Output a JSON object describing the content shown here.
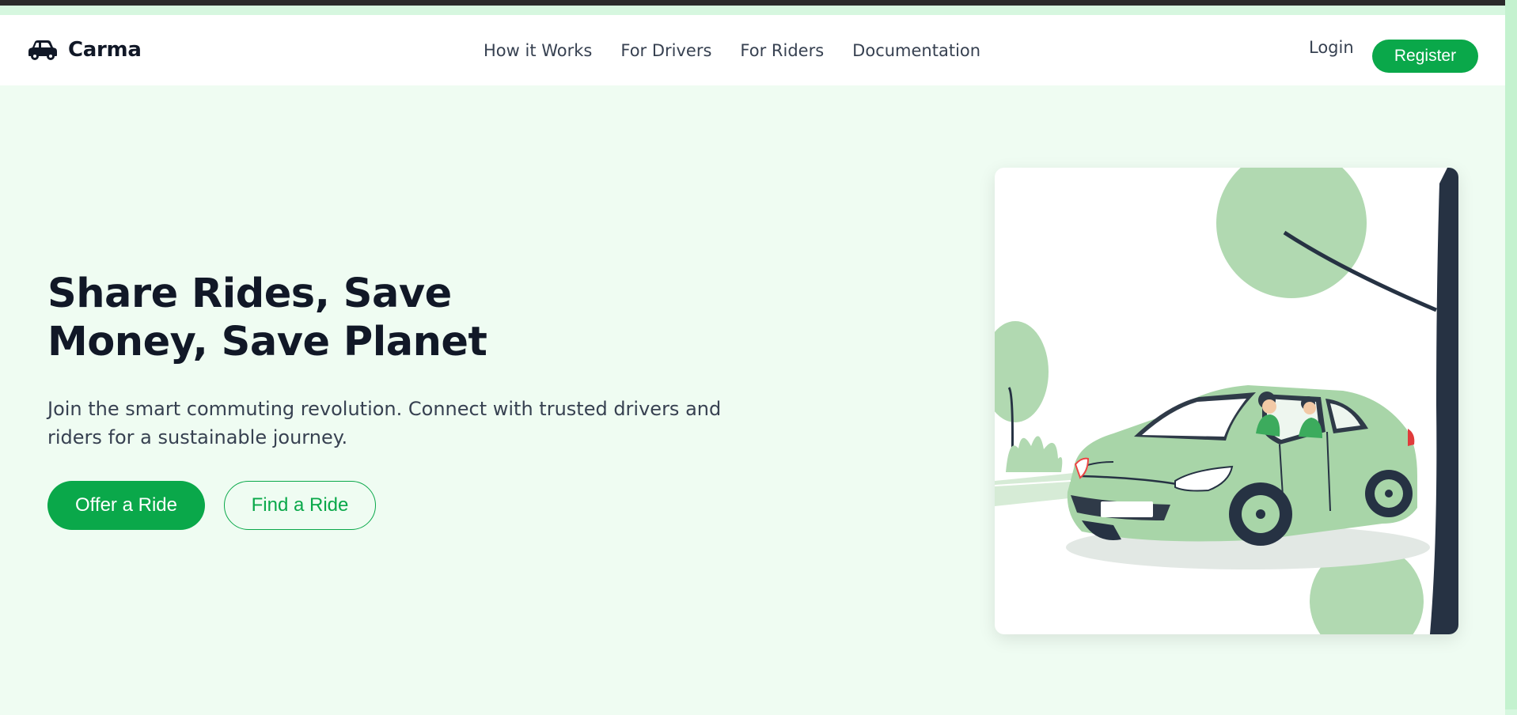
{
  "brand": {
    "name": "Carma",
    "icon": "car-icon"
  },
  "nav": {
    "links": [
      "How it Works",
      "For Drivers",
      "For Riders",
      "Documentation"
    ],
    "login": "Login",
    "register": "Register"
  },
  "hero": {
    "title_line1": "Share Rides, Save",
    "title_line2": "Money, Save Planet",
    "subtitle_line1": "Join the smart commuting revolution. Connect with trusted drivers and",
    "subtitle_line2": "riders for a sustainable journey.",
    "offer_button": "Offer a Ride",
    "find_button": "Find a Ride",
    "illustration": "car-illustration"
  },
  "colors": {
    "accent": "#0aa84a",
    "page_bg": "#effcf2",
    "heading": "#111827",
    "text": "#374151",
    "illustration_green": "#a8d5a8",
    "tree_trunk": "#263243"
  }
}
